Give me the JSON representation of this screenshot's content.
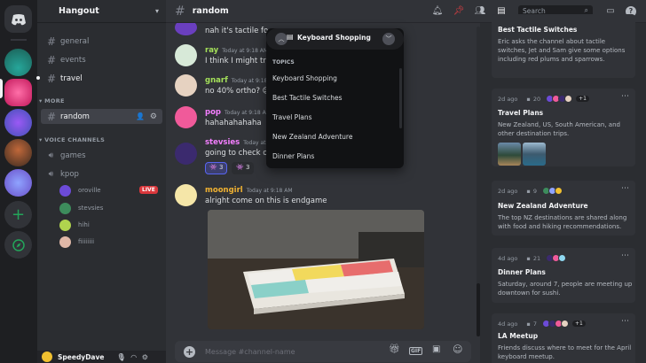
{
  "server": {
    "name": "Hangout"
  },
  "channels": {
    "text": [
      {
        "label": "general"
      },
      {
        "label": "events"
      },
      {
        "label": "travel"
      }
    ],
    "more_label": "MORE",
    "selected": "random",
    "voice_label": "VOICE CHANNELS",
    "voice": [
      {
        "label": "games"
      },
      {
        "label": "kpop"
      }
    ],
    "voice_users": [
      {
        "name": "oroville",
        "badge": "LIVE"
      },
      {
        "name": "stevsies"
      },
      {
        "name": "hihi"
      },
      {
        "name": "fiiiiiiii"
      }
    ]
  },
  "user": {
    "name": "SpeedyDave"
  },
  "header": {
    "channel": "random",
    "search_placeholder": "Search"
  },
  "messages": [
    {
      "text": "nah it's tactile fo"
    },
    {
      "author": "ray",
      "time": "Today at 9:18 AM",
      "text": "I think I might try",
      "color": "#a4e05a"
    },
    {
      "author": "gnarf",
      "time": "Today at 9:18 AM",
      "text": "no 40% ortho? 😉",
      "color": "#a4e05a"
    },
    {
      "author": "pop",
      "time": "Today at 9:18 AM",
      "text": "hahahahahaha",
      "color": "#f47fff"
    },
    {
      "author": "stevsies",
      "time": "Today at 9:18 AM",
      "text": "going to check ou",
      "color": "#f47fff"
    },
    {
      "author": "moongirl",
      "time": "Today at 9:18 AM",
      "text": "alright come on this is endgame",
      "color": "#f0b232"
    }
  ],
  "reactions": [
    {
      "count": "3"
    },
    {
      "count": "3"
    }
  ],
  "composer": {
    "placeholder": "Message #channel-name"
  },
  "dropdown": {
    "title": "Keyboard Shopping",
    "section": "TOPICS",
    "items": [
      "Keyboard Shopping",
      "Best Tactile Switches",
      "Travel Plans",
      "New Zealand Adventure",
      "Dinner Plans"
    ]
  },
  "threads": [
    {
      "title": "Best Tactile Switches",
      "desc": "Eric asks the channel about tactile switches, Jet and Sam give some options including red plums and sparrows."
    },
    {
      "age": "2d ago",
      "replies": "20",
      "extra": "+1",
      "title": "Travel Plans",
      "desc": "New Zealand, US, South American, and other destination trips."
    },
    {
      "age": "2d ago",
      "replies": "9",
      "title": "New Zealand Adventure",
      "desc": "The top NZ destinations are shared along with food and hiking recommendations."
    },
    {
      "age": "4d ago",
      "replies": "21",
      "title": "Dinner Plans",
      "desc": "Saturday, around 7, people are meeting up downtown for sushi."
    },
    {
      "age": "4d ago",
      "replies": "7",
      "extra": "+1",
      "title": "LA Meetup",
      "desc": "Friends discuss where to meet for the April keyboard meetup."
    }
  ]
}
